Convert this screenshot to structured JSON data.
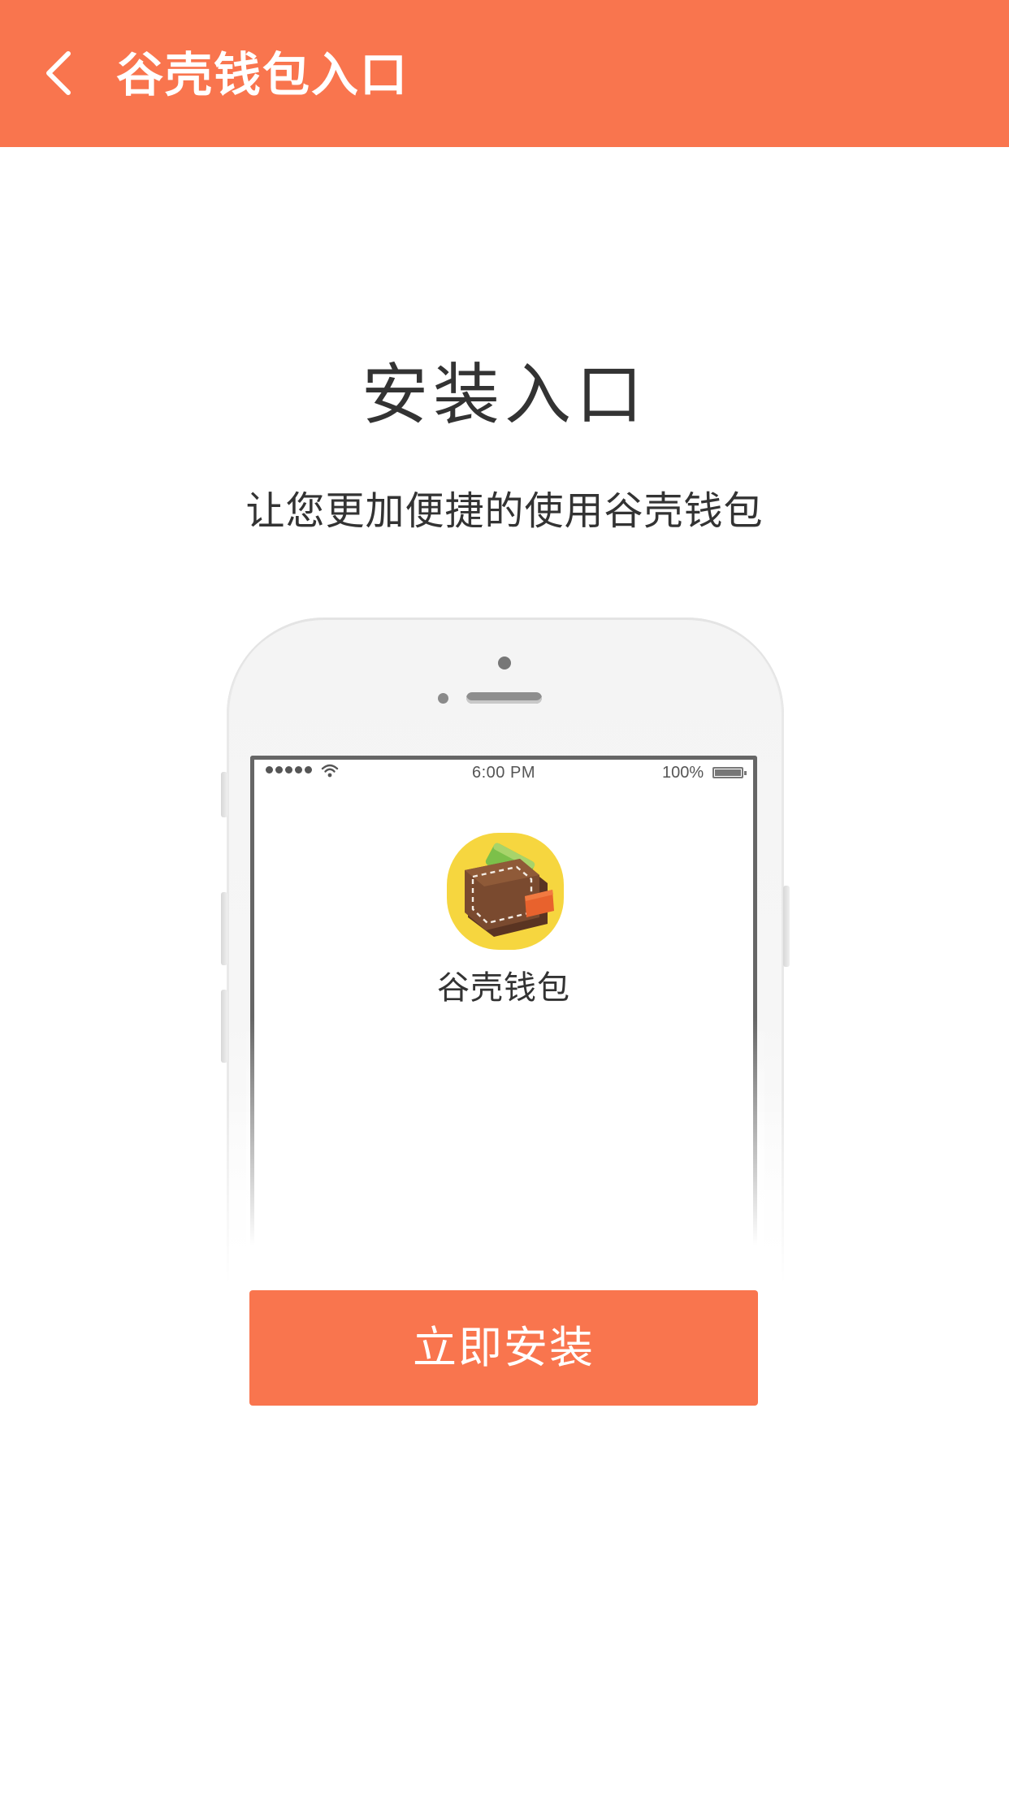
{
  "colors": {
    "accent": "#f9754e",
    "text": "#333333",
    "background": "#ffffff"
  },
  "nav": {
    "back_icon": "chevron-left-icon",
    "title": "谷壳钱包入口"
  },
  "main": {
    "title": "安装入口",
    "subtitle": "让您更加便捷的使用谷壳钱包"
  },
  "phone_mockup": {
    "status_bar": {
      "time": "6:00 PM",
      "battery": "100%",
      "signal_icon": "signal-dots-icon",
      "wifi_icon": "wifi-icon",
      "battery_icon": "battery-icon"
    },
    "app": {
      "icon": "wallet-app-icon",
      "label": "谷壳钱包"
    }
  },
  "install_button": {
    "label": "立即安装"
  }
}
